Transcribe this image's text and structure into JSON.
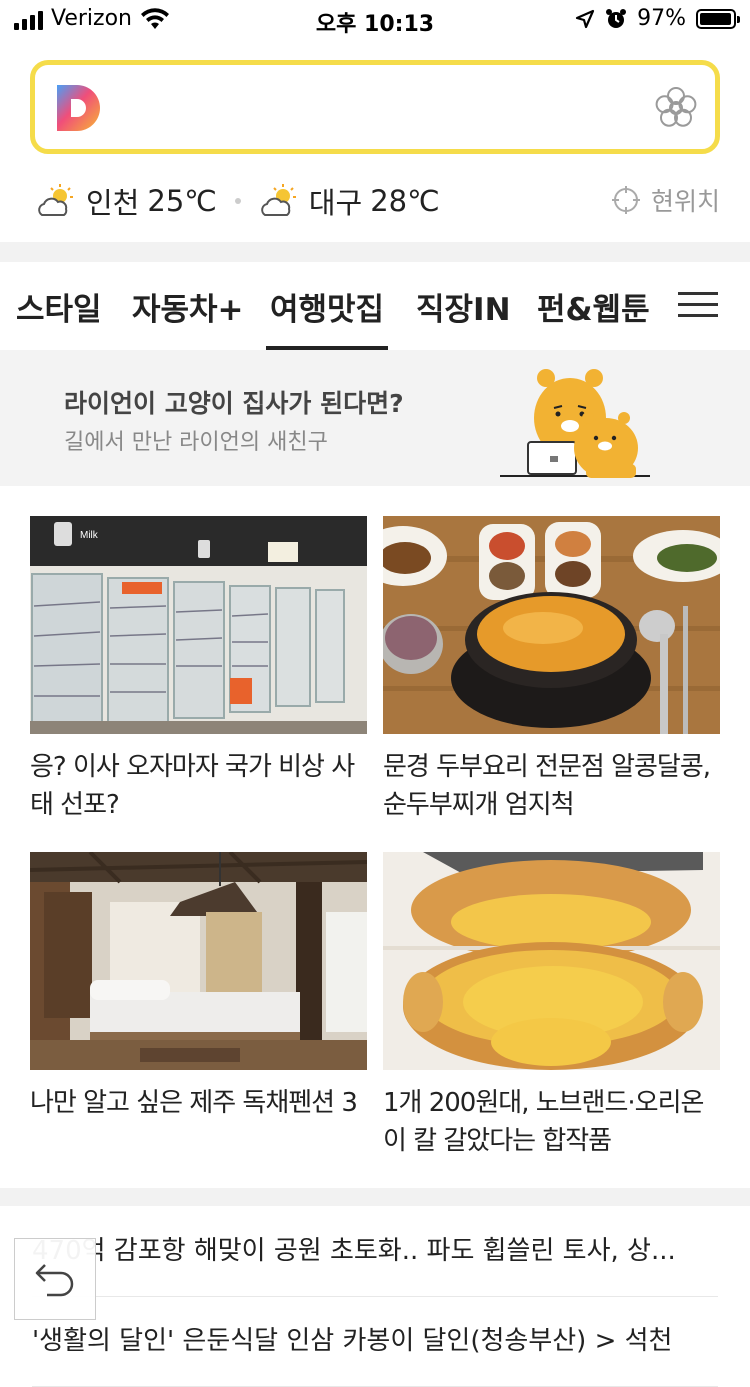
{
  "status": {
    "carrier": "Verizon",
    "time": "오후 10:13",
    "battery": "97%",
    "battery_level": 0.97,
    "icons": [
      "signal-icon",
      "wifi-icon",
      "location-arrow-icon",
      "alarm-icon",
      "battery-icon"
    ]
  },
  "search": {
    "logo": "daum-d-logo",
    "value": "",
    "flower_icon": "flower-icon",
    "border_color": "#f5dc4a"
  },
  "weather": {
    "items": [
      {
        "city": "인천",
        "temp": "25℃",
        "icon": "partly-sunny-icon"
      },
      {
        "city": "대구",
        "temp": "28℃",
        "icon": "partly-sunny-icon"
      }
    ],
    "location_label": "현위치"
  },
  "tabs": {
    "items": [
      "스타일",
      "자동차+",
      "여행맛집",
      "직장IN",
      "펀&웹툰"
    ],
    "active": "여행맛집"
  },
  "banner": {
    "title": "라이언이 고양이 집사가 된다면?",
    "subtitle": "길에서 만난 라이언의 새친구"
  },
  "cards": [
    {
      "title": "응? 이사 오자마자 국가 비상 사태 선포?",
      "thumb": "empty-milk-fridges-photo",
      "milk": "Milk"
    },
    {
      "title": "문경 두부요리 전문점 알콩달콩, 순두부찌개 엄지척",
      "thumb": "tofu-stew-photo"
    },
    {
      "title": "나만 알고 싶은 제주 독채펜션 3",
      "thumb": "hanok-bedroom-photo"
    },
    {
      "title": "1개 200원대, 노브랜드·오리온이 칼 갈았다는 합작품",
      "thumb": "custard-pastry-photo"
    }
  ],
  "list": [
    "470억 감포항 해맞이 공원 초토화.. 파도 휩쓸린 토사, 상...",
    "'생활의 달인' 은둔식달 인삼 카봉이 달인(청송부산) > 석천"
  ],
  "back_button": "back-arrow-icon"
}
